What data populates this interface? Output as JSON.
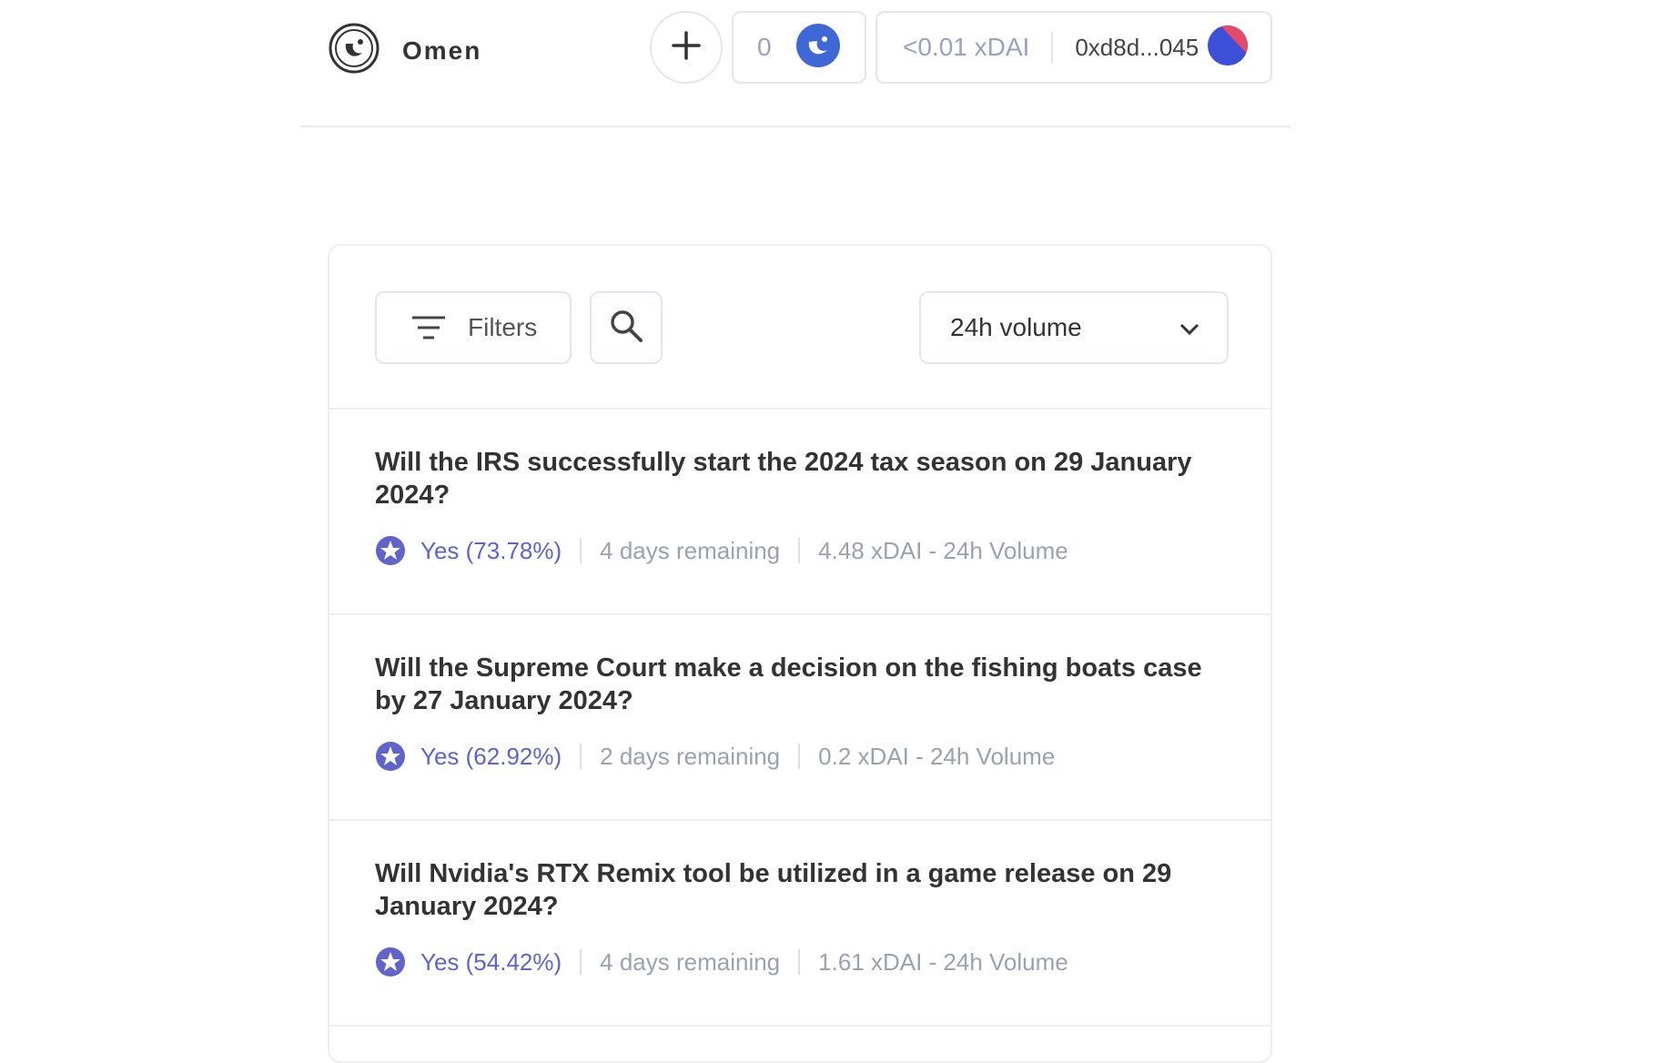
{
  "header": {
    "app_name": "Omen",
    "omen_balance": "0",
    "xdai_balance": "<0.01 xDAI",
    "address": "0xd8d...045"
  },
  "toolbar": {
    "filters_label": "Filters",
    "sort_value": "24h volume"
  },
  "markets": [
    {
      "title": "Will the IRS successfully start the 2024 tax season on 29 January 2024?",
      "outcome": "Yes (73.78%)",
      "remaining": "4 days remaining",
      "volume": "4.48 xDAI - 24h Volume"
    },
    {
      "title": "Will the Supreme Court make a decision on the fishing boats case by 27 January 2024?",
      "outcome": "Yes (62.92%)",
      "remaining": "2 days remaining",
      "volume": "0.2 xDAI - 24h Volume"
    },
    {
      "title": "Will Nvidia's RTX Remix tool be utilized in a game release on 29 January 2024?",
      "outcome": "Yes (54.42%)",
      "remaining": "4 days remaining",
      "volume": "1.61 xDAI - 24h Volume"
    }
  ],
  "colors": {
    "accent": "#6063c8",
    "omen_blue": "#3f68d6",
    "avatar_red": "#e64a6a",
    "avatar_blue": "#3b4fd8"
  }
}
